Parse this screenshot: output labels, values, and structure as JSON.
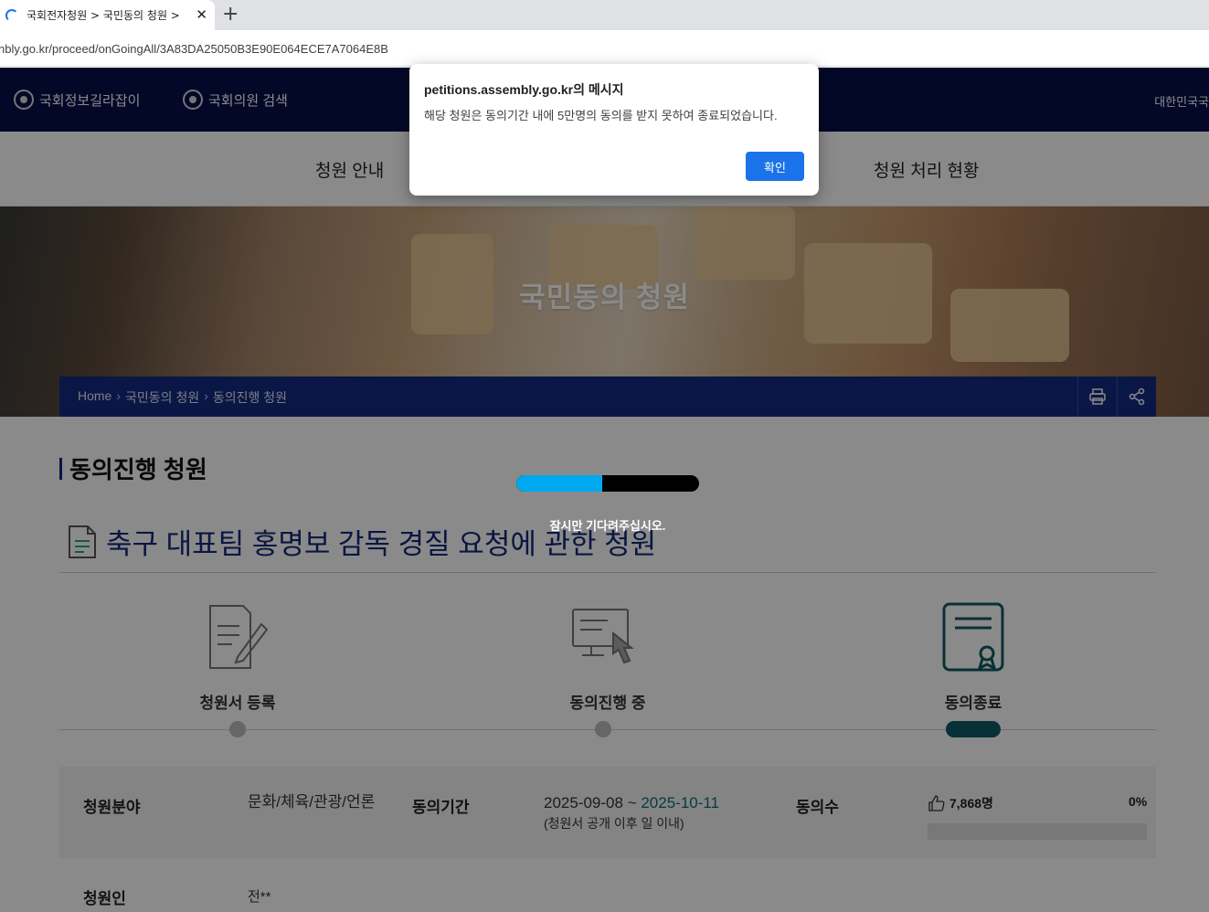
{
  "browser": {
    "tab_title": "국회전자청원 > 국민동의 청원 >",
    "tab_close": "✕",
    "new_tab": "+",
    "url": "nbly.go.kr/proceed/onGoingAll/3A83DA25050B3E90E064ECE7A7064E8B"
  },
  "topnav": {
    "links": [
      "국회정보길라잡이",
      "국회의원 검색"
    ],
    "right_text": "대한민국국"
  },
  "mainnav": {
    "items": [
      "청원 안내",
      "청원 처리 현황"
    ]
  },
  "hero": {
    "title": "국민동의 청원"
  },
  "breadcrumb": {
    "home": "Home",
    "sep": "›",
    "level1": "국민동의 청원",
    "level2": "동의진행 청원"
  },
  "section": {
    "title": "동의진행 청원"
  },
  "petition": {
    "title": "축구 대표팀 홍명보 감독 경질 요청에 관한 청원"
  },
  "steps": [
    {
      "label": "청원서 등록",
      "icon": "register-icon",
      "active": false
    },
    {
      "label": "동의진행 중",
      "icon": "in-progress-icon",
      "active": false
    },
    {
      "label": "동의종료",
      "icon": "certificate-icon",
      "active": true
    }
  ],
  "info": {
    "field_label": "청원분야",
    "field_value": "문화/체육/관광/언론",
    "period_label": "동의기간",
    "period_start": "2025-09-08",
    "period_tilde": " ~ ",
    "period_end": "2025-10-11",
    "period_note": "(청원서 공개 이후 일 이내)",
    "agree_label": "동의수",
    "agree_count": "7,868명",
    "agree_percent": "0%",
    "agree_fraction": 0,
    "petitioner_label": "청원인",
    "petitioner_value": "전**"
  },
  "loading": {
    "text": "잠시만 기다려주십시오.",
    "progress": 0.47,
    "colors": {
      "fill": "#00a8f0",
      "track": "#000000"
    }
  },
  "dialog": {
    "title": "petitions.assembly.go.kr의 메시지",
    "message": "해당 청원은 동의기간 내에 5만명의 동의를 받지 못하여 종료되었습니다.",
    "ok_label": "확인"
  },
  "colors": {
    "navy": "#06104a",
    "breadcrumb_bar": "#142b82",
    "petition_title": "#13297a",
    "accent_teal": "#0d5c64",
    "dialog_button": "#1a73e8"
  }
}
